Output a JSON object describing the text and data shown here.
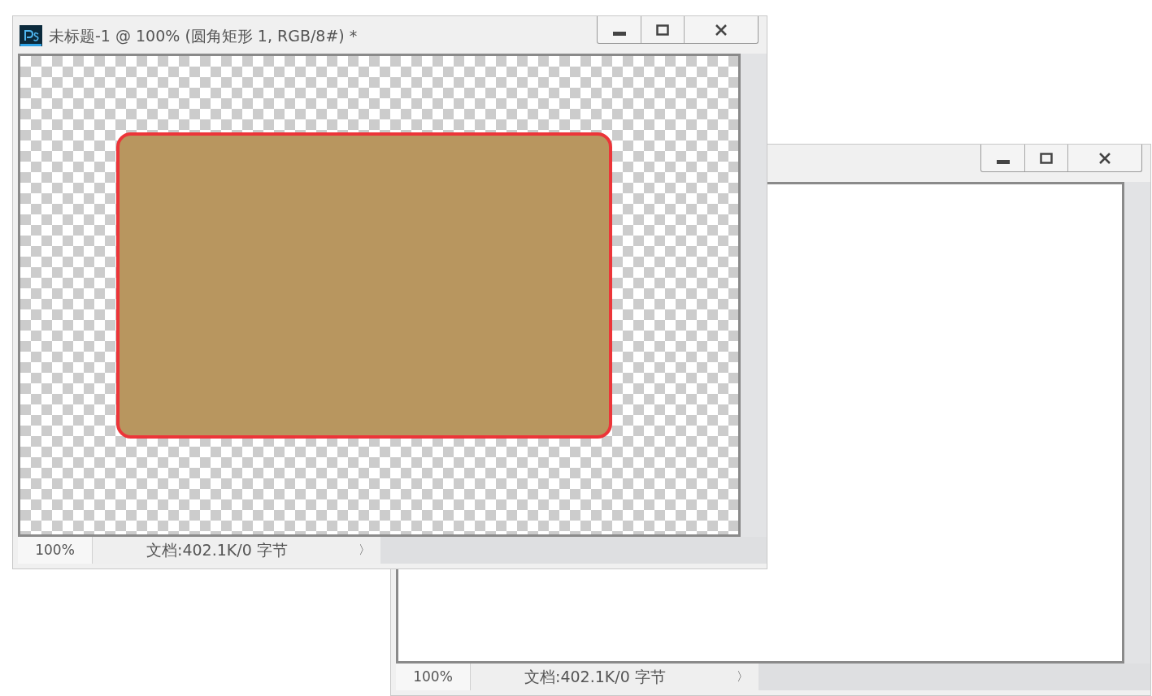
{
  "windows": [
    {
      "kind": "blank",
      "zoom": "100%",
      "doc_info": "文档:402.1K/0 字节",
      "nav_arrow": "〉"
    },
    {
      "kind": "layer",
      "title": "未标题-1 @ 100% (圆角矩形 1, RGB/8#) *",
      "zoom": "100%",
      "doc_info": "文档:402.1K/0 字节",
      "nav_arrow": "〉"
    }
  ]
}
